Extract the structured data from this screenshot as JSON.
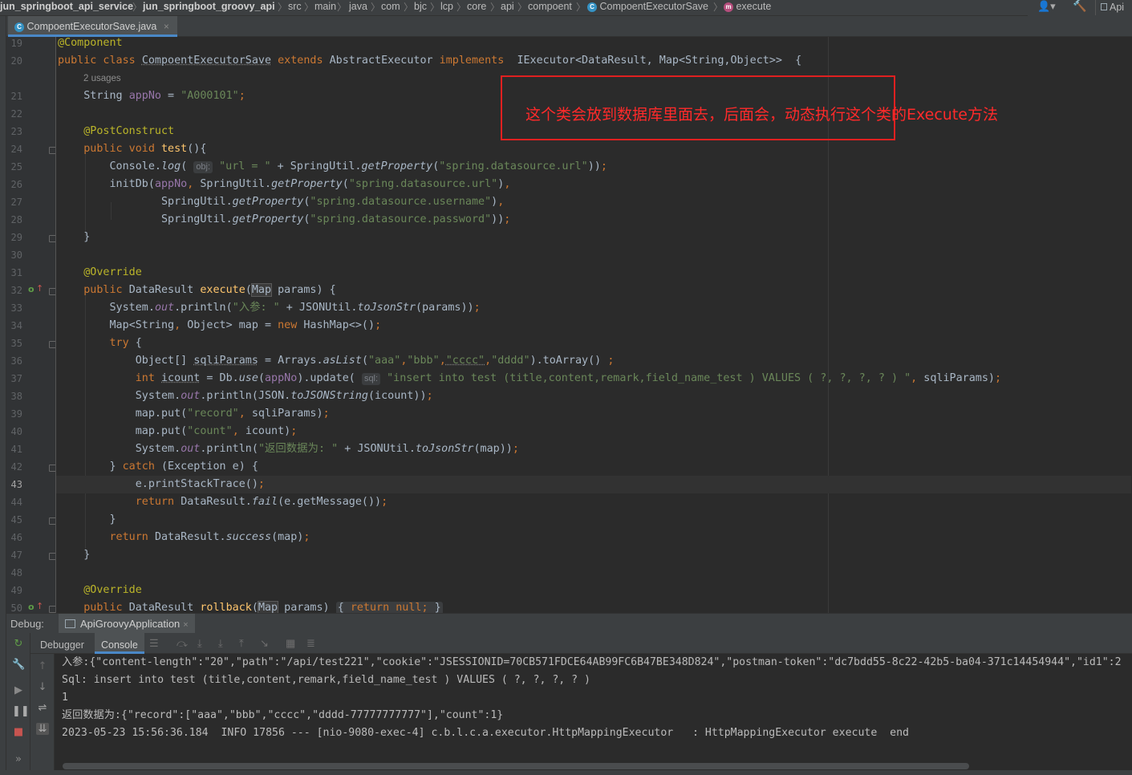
{
  "breadcrumb": {
    "items": [
      "jun_springboot_api_service",
      "jun_springboot_groovy_api",
      "src",
      "main",
      "java",
      "com",
      "bjc",
      "lcp",
      "core",
      "api",
      "compoent",
      "CompoentExecutorSave",
      "execute"
    ],
    "right_label": "Api"
  },
  "editor_tab": {
    "file_name": "CompoentExecutorSave.java",
    "icon": "class-icon"
  },
  "gutter": {
    "line_numbers": [
      "19",
      "20",
      "",
      "21",
      "22",
      "23",
      "24",
      "25",
      "26",
      "27",
      "28",
      "29",
      "30",
      "31",
      "32",
      "33",
      "34",
      "35",
      "36",
      "37",
      "38",
      "39",
      "40",
      "41",
      "42",
      "43",
      "44",
      "45",
      "46",
      "47",
      "48",
      "49",
      "50"
    ],
    "current_line": "43"
  },
  "code": {
    "usages": "2 usages",
    "hint_obj": "obj:",
    "hint_sql": "sql:"
  },
  "annotation": {
    "text": "这个类会放到数据库里面去，后面会，动态执行这个类的Execute方法",
    "color": "#e02020"
  },
  "debug": {
    "label": "Debug:",
    "session": "ApiGroovyApplication",
    "tabs": [
      "Debugger",
      "Console"
    ],
    "active_tab": "Console"
  },
  "console": {
    "lines": [
      "入参:{\"content-length\":\"20\",\"path\":\"/api/test221\",\"cookie\":\"JSESSIONID=70CB571FDCE64AB99FC6B47BE348D824\",\"postman-token\":\"dc7bdd55-8c22-42b5-ba04-371c14454944\",\"id1\":2",
      "Sql: insert into test (title,content,remark,field_name_test ) VALUES ( ?, ?, ?, ? )",
      "1",
      "返回数据为:{\"record\":[\"aaa\",\"bbb\",\"cccc\",\"dddd-77777777777\"],\"count\":1}",
      "2023-05-23 15:56:36.184  INFO 17856 --- [nio-9080-exec-4] c.b.l.c.a.executor.HttpMappingExecutor   : HttpMappingExecutor execute  end"
    ]
  },
  "colors": {
    "keyword": "#cc7832",
    "string": "#6a8759",
    "annotation": "#bbb529",
    "field": "#9876aa",
    "method": "#ffc66d"
  }
}
